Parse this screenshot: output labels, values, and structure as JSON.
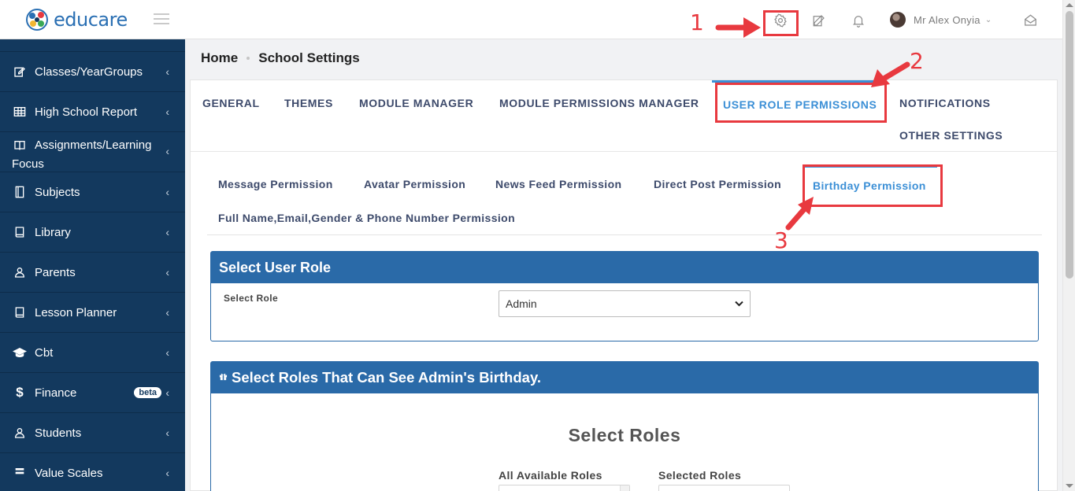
{
  "app": {
    "logo_text": "educare"
  },
  "topbar": {
    "user_name": "Mr Alex Onyia",
    "user_chevron": "⌄",
    "icons": [
      "gear-icon",
      "edit-icon",
      "bell-icon",
      "mail-icon"
    ]
  },
  "sidebar": {
    "items": [
      {
        "label": "Classes/YearGroups",
        "icon": "edit-icon"
      },
      {
        "label": "High School Report",
        "icon": "table-icon"
      },
      {
        "label": "Assignments/Learning Focus",
        "line1": "Assignments/Learning",
        "line2": "Focus",
        "icon": "book-icon"
      },
      {
        "label": "Subjects",
        "icon": "subjects-icon"
      },
      {
        "label": "Library",
        "icon": "library-icon"
      },
      {
        "label": "Parents",
        "icon": "user-icon"
      },
      {
        "label": "Lesson Planner",
        "icon": "planner-icon"
      },
      {
        "label": "Cbt",
        "icon": "graduation-cap-icon"
      },
      {
        "label": "Finance",
        "icon": "dollar-icon",
        "badge": "beta"
      },
      {
        "label": "Students",
        "icon": "user-icon"
      },
      {
        "label": "Value Scales",
        "icon": "scale-icon"
      }
    ],
    "chevron": "‹"
  },
  "breadcrumb": {
    "home": "Home",
    "current": "School Settings"
  },
  "main_tabs": [
    {
      "label": "GENERAL"
    },
    {
      "label": "THEMES"
    },
    {
      "label": "MODULE MANAGER"
    },
    {
      "label": "MODULE PERMISSIONS MANAGER"
    },
    {
      "label": "USER ROLE PERMISSIONS",
      "active": true
    },
    {
      "label": "NOTIFICATIONS"
    },
    {
      "label": "OTHER SETTINGS"
    }
  ],
  "sub_tabs": [
    {
      "label": "Message Permission"
    },
    {
      "label": "Avatar Permission"
    },
    {
      "label": "News Feed Permission"
    },
    {
      "label": "Direct Post Permission"
    },
    {
      "label": "Birthday Permission",
      "active": true
    },
    {
      "label": "Full Name,Email,Gender & Phone Number Permission"
    }
  ],
  "select_user_role": {
    "title": "Select User Role",
    "label": "Select Role",
    "value": "Admin"
  },
  "birthday_panel": {
    "title": "Select Roles That Can See Admin's Birthday.",
    "heading": "Select Roles",
    "available_label": "All Available Roles",
    "selected_label": "Selected Roles"
  },
  "annotations": {
    "n1": "1",
    "n2": "2",
    "n3": "3",
    "color": "#e8393f"
  },
  "colors": {
    "sidebar": "#13395e",
    "panel_header": "#2a6aa8",
    "active_tab": "#3b8fd6",
    "tab_text": "#3d4a6b"
  }
}
